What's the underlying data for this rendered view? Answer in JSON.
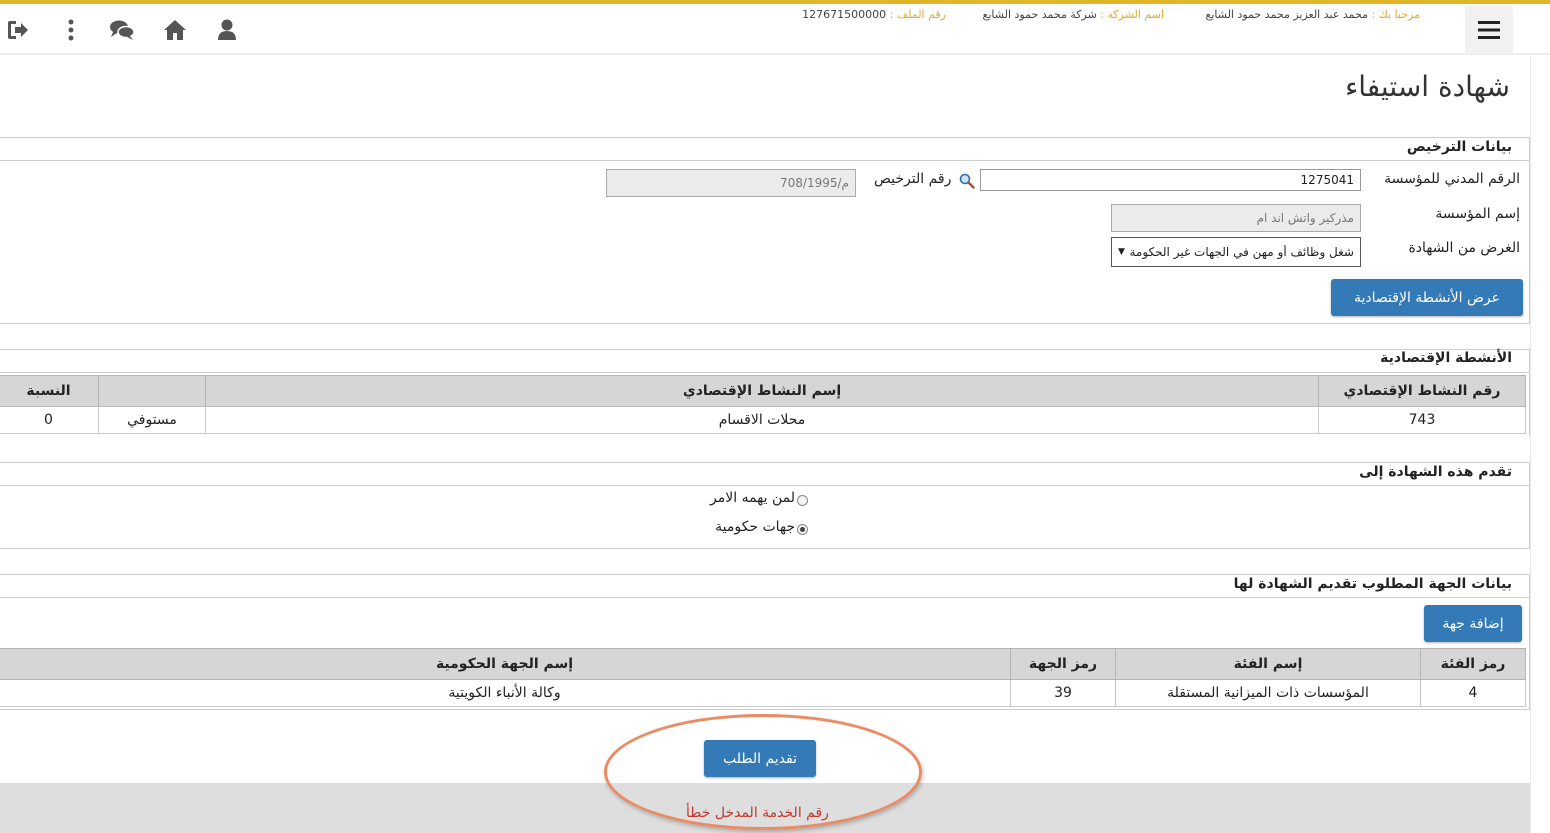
{
  "header": {
    "welcome_label": "مرحبا بك :",
    "user_name": "محمد عبد العزيز محمد حمود الشايع",
    "company_label": "اسم الشركة :",
    "company_name": "شركة محمد حمود الشايع",
    "file_label": "رقم الملف :",
    "file_number": "127671500000",
    "icons": [
      "menu-icon",
      "user-icon",
      "home-icon",
      "chat-icon",
      "more-icon",
      "logout-icon"
    ]
  },
  "page": {
    "title": "شهادة استيفاء"
  },
  "license": {
    "heading": "بيانات الترخيص",
    "civil_id_label": "الرقم المدني للمؤسسة",
    "civil_id_value": "1275041",
    "license_no_label": "رقم الترخيص",
    "license_no_value": "م/708/1995",
    "org_name_label": "إسم المؤسسة",
    "org_name_value": "مذركير  واتش اند ام",
    "purpose_label": "الغرض من الشهادة",
    "purpose_value": "شغل وظائف أو مهن في الجهات غير الحكومة",
    "show_activities_button": "عرض الأنشطة الإقتصادية"
  },
  "activities": {
    "heading": "الأنشطة الإقتصادية",
    "columns": [
      "رقم النشاط الإقتصادي",
      "إسم النشاط الإقتصادي",
      "",
      "النسبة"
    ],
    "rows": [
      {
        "number": "743",
        "name": "محلات الاقسام",
        "status": "مستوفي",
        "ratio": "0"
      }
    ]
  },
  "submit_to": {
    "heading": "تقدم هذه الشهادة إلى",
    "options": [
      {
        "label": "لمن يهمه الامر",
        "selected": false
      },
      {
        "label": "جهات حكومية",
        "selected": true
      }
    ]
  },
  "entity": {
    "heading": "بيانات الجهة المطلوب تقديم الشهادة لها",
    "add_button": "إضافة جهة",
    "columns": [
      "رمز الفئة",
      "إسم الفئة",
      "رمز الجهة",
      "إسم الجهة الحكومية"
    ],
    "rows": [
      {
        "cat_code": "4",
        "cat_name": "المؤسسات ذات الميزانية المستقلة",
        "entity_code": "39",
        "entity_name": "وكالة الأنباء الكويتية"
      }
    ]
  },
  "footer": {
    "submit_button": "تقديم الطلب",
    "error_message": "رقم الخدمة المدخل خطأ"
  },
  "colors": {
    "accent": "#e0b526",
    "button": "#337ab7",
    "error": "#c0392b",
    "highlight": "#ec8b63"
  }
}
